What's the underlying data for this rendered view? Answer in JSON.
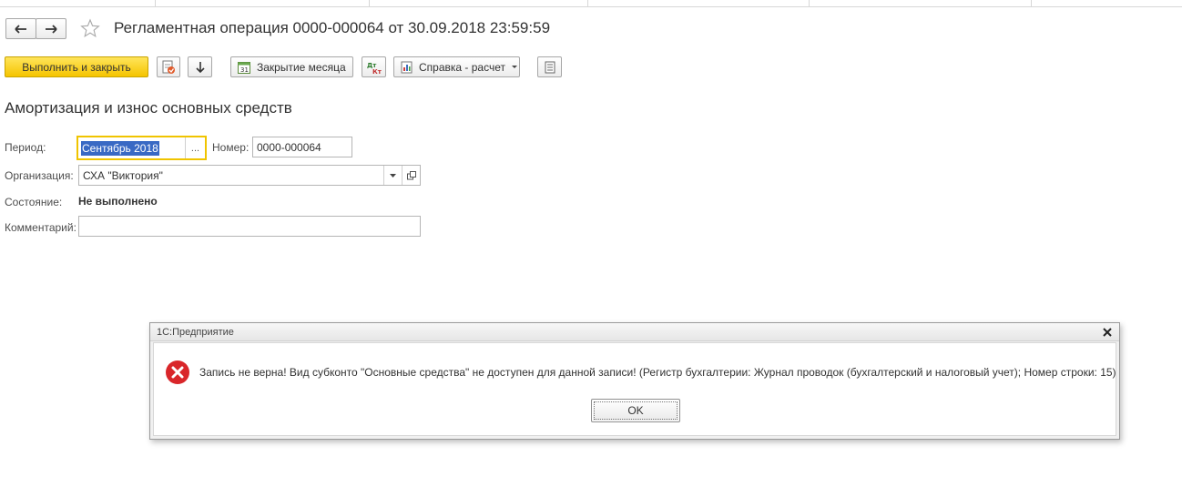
{
  "window": {
    "title": "Регламентная операция 0000-000064 от 30.09.2018 23:59:59"
  },
  "toolbar": {
    "execute_close_label": "Выполнить и закрыть",
    "month_close_label": "Закрытие месяца",
    "reference_calc_label": "Справка - расчет"
  },
  "section": {
    "title": "Амортизация и износ основных средств"
  },
  "form": {
    "period_label": "Период:",
    "period_value": "Сентябрь 2018",
    "period_button": "...",
    "number_label": "Номер:",
    "number_value": "0000-000064",
    "org_label": "Организация:",
    "org_value": "СХА \"Виктория\"",
    "state_label": "Состояние:",
    "state_value": "Не выполнено",
    "comment_label": "Комментарий:",
    "comment_value": ""
  },
  "dialog": {
    "title": "1С:Предприятие",
    "message": "Запись не верна! Вид субконто \"Основные средства\" не доступен для данной записи! (Регистр бухгалтерии: Журнал проводок (бухгалтерский и налоговый учет); Номер строки: 15)",
    "ok_label": "OK"
  },
  "colors": {
    "primary_button": "#f5c400",
    "focus_border": "#f0c400",
    "selection": "#3969c4",
    "error_icon": "#d9262a"
  },
  "icons": [
    "back-arrow-icon",
    "forward-arrow-icon",
    "favorite-star-icon",
    "post-document-icon",
    "download-arrow-icon",
    "calendar-icon",
    "dt-kt-icon",
    "report-icon",
    "dropdown-arrow-icon",
    "list-icon",
    "open-icon",
    "close-icon",
    "error-icon"
  ]
}
